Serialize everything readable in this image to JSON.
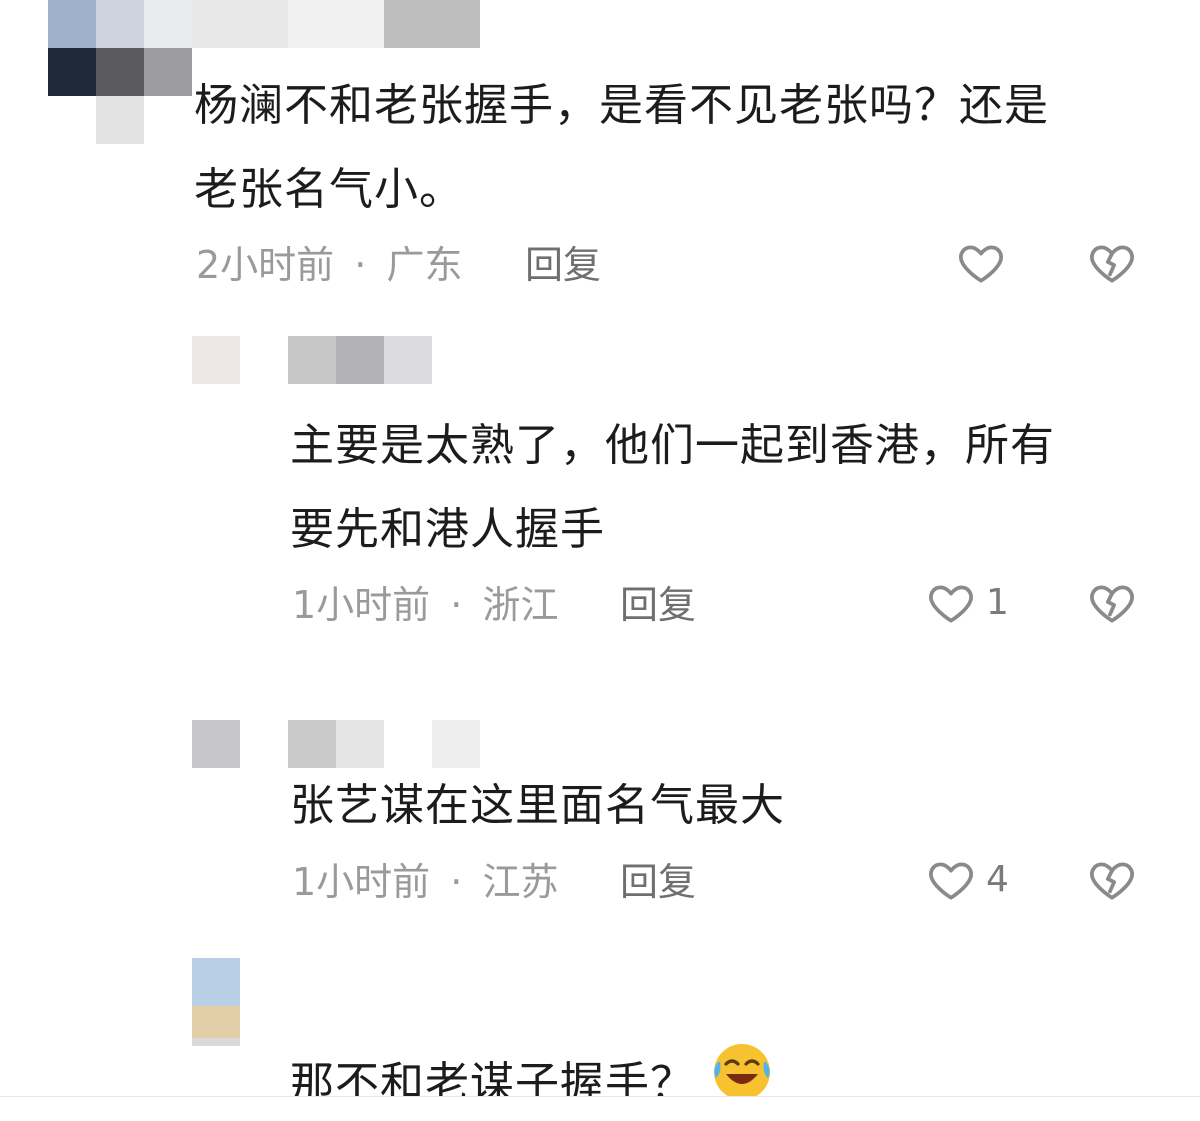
{
  "comments": [
    {
      "text_line1": "杨澜不和老张握手，是看不见老张吗？还是",
      "text_line2": "老张名气小。",
      "time": "2小时前",
      "location": "广东",
      "separator": "·",
      "reply_label": "回复",
      "likes": ""
    },
    {
      "text_line1": "主要是太熟了，他们一起到香港，所有",
      "text_line2": "要先和港人握手",
      "time": "1小时前",
      "location": "浙江",
      "separator": "·",
      "reply_label": "回复",
      "likes": "1"
    },
    {
      "text_line1": "张艺谋在这里面名气最大",
      "time": "1小时前",
      "location": "江苏",
      "separator": "·",
      "reply_label": "回复",
      "likes": "4"
    },
    {
      "text_line1": "那不和老谋子握手？",
      "emoji": "laughing-crying-emoji"
    }
  ],
  "icons": {
    "like": "heart-outline-icon",
    "dislike": "broken-heart-icon"
  },
  "colors": {
    "text": "#1c1c1c",
    "meta": "#9a9a9a",
    "icon": "#8a8a8a"
  }
}
